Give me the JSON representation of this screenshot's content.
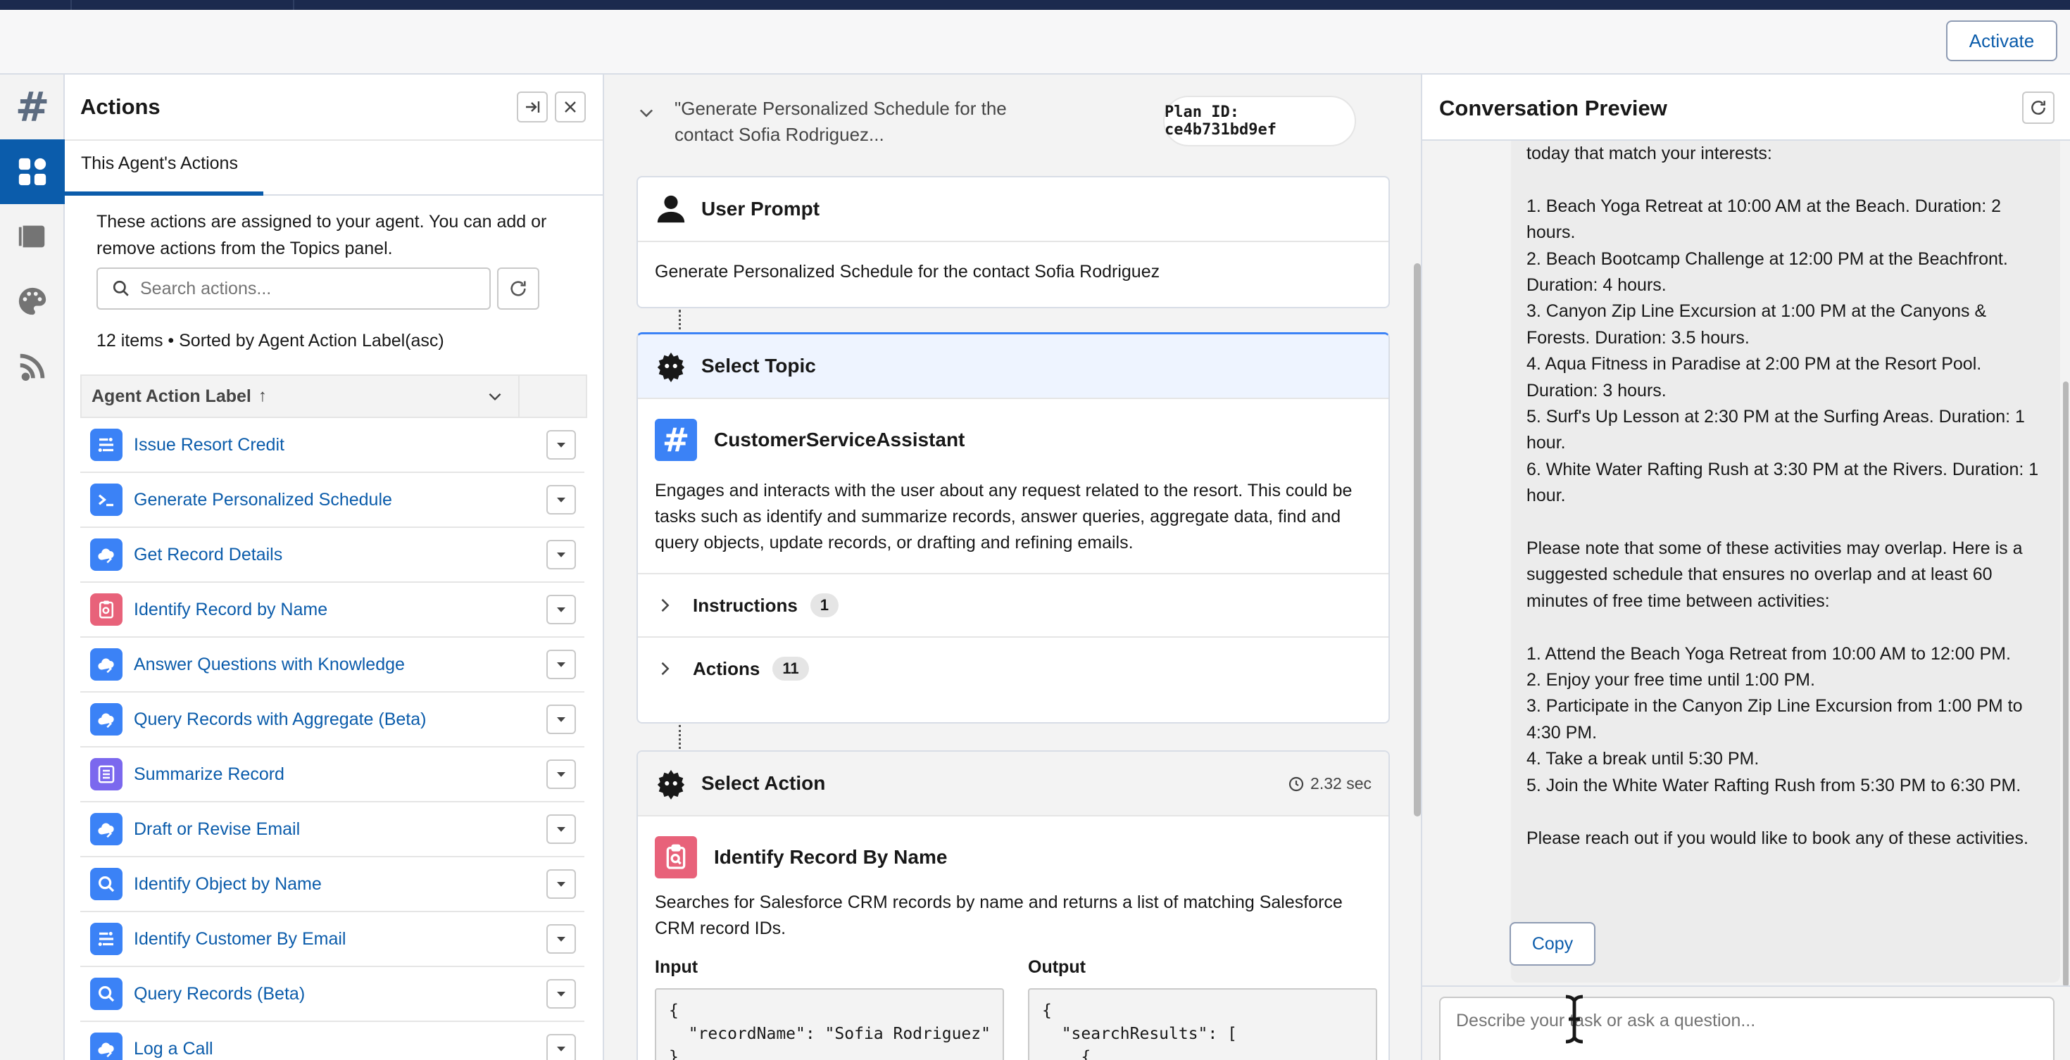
{
  "header": {
    "activate_label": "Activate"
  },
  "rail": {
    "items": [
      {
        "icon": "hash-icon"
      },
      {
        "icon": "apps-icon",
        "active": true
      },
      {
        "icon": "book-icon"
      },
      {
        "icon": "palette-icon"
      },
      {
        "icon": "signal-icon"
      }
    ]
  },
  "actions_panel": {
    "title": "Actions",
    "tab_label": "This Agent's Actions",
    "description": "These actions are assigned to your agent. You can add or remove actions from the Topics panel.",
    "search_placeholder": "Search actions...",
    "count_text": "12 items • Sorted by Agent Action Label(asc)",
    "column_header": "Agent Action Label",
    "sort_arrow": "↑",
    "rows": [
      {
        "label": "Issue Resort Credit",
        "icon": "flow-icon",
        "color": "#3b82f6"
      },
      {
        "label": "Generate Personalized Schedule",
        "icon": "prompt-icon",
        "color": "#3b82f6"
      },
      {
        "label": "Get Record Details",
        "icon": "cloud-icon",
        "color": "#3b82f6"
      },
      {
        "label": "Identify Record by Name",
        "icon": "clipboard-icon",
        "color": "#e8627a"
      },
      {
        "label": "Answer Questions with Knowledge",
        "icon": "cloud-icon",
        "color": "#3b82f6"
      },
      {
        "label": "Query Records with Aggregate (Beta)",
        "icon": "cloud-icon",
        "color": "#3b82f6"
      },
      {
        "label": "Summarize Record",
        "icon": "list-icon",
        "color": "#7b68ee"
      },
      {
        "label": "Draft or Revise Email",
        "icon": "cloud-icon",
        "color": "#3b82f6"
      },
      {
        "label": "Identify Object by Name",
        "icon": "search-icon",
        "color": "#3b82f6"
      },
      {
        "label": "Identify Customer By Email",
        "icon": "flow-icon",
        "color": "#3b82f6"
      },
      {
        "label": "Query Records (Beta)",
        "icon": "search-icon",
        "color": "#3b82f6"
      },
      {
        "label": "Log a Call",
        "icon": "cloud-icon",
        "color": "#3b82f6"
      }
    ]
  },
  "plan": {
    "title": "\"Generate Personalized Schedule for the contact Sofia Rodriguez...",
    "plan_id": "Plan ID: ce4b731bd9ef",
    "user_prompt": {
      "title": "User Prompt",
      "text": "Generate Personalized Schedule for the contact Sofia Rodriguez"
    },
    "select_topic": {
      "title": "Select Topic",
      "topic_name": "CustomerServiceAssistant",
      "topic_description": "Engages and interacts with the user about any request related to the resort. This could be tasks such as identify and summarize records, answer queries, aggregate data, find and query objects, update records, or drafting and refining emails.",
      "instructions_label": "Instructions",
      "instructions_count": "1",
      "actions_label": "Actions",
      "actions_count": "11"
    },
    "select_action": {
      "title": "Select Action",
      "timing": "2.32 sec",
      "action_name": "Identify Record By Name",
      "action_description": "Searches for Salesforce CRM records by name and returns a list of matching Salesforce CRM record IDs.",
      "input_label": "Input",
      "output_label": "Output",
      "input_code": "{\n  \"recordName\": \"Sofia Rodriguez\"\n}",
      "output_code": "{\n  \"searchResults\": [\n    {"
    }
  },
  "conversation": {
    "title": "Conversation Preview",
    "lines": [
      "today that match your interests:",
      "",
      "1. Beach Yoga Retreat at 10:00 AM at the Beach. Duration: 2 hours.",
      "2. Beach Bootcamp Challenge at 12:00 PM at the Beachfront. Duration: 4 hours.",
      "3. Canyon Zip Line Excursion at 1:00 PM at the Canyons & Forests. Duration: 3.5 hours.",
      "4. Aqua Fitness in Paradise at 2:00 PM at the Resort Pool. Duration: 3 hours.",
      "5. Surf's Up Lesson at 2:30 PM at the Surfing Areas. Duration: 1 hour.",
      "6. White Water Rafting Rush at 3:30 PM at the Rivers. Duration: 1 hour.",
      "",
      "Please note that some of these activities may overlap. Here is a suggested schedule that ensures no overlap and at least 60 minutes of free time between activities:",
      "",
      "1. Attend the Beach Yoga Retreat from 10:00 AM to 12:00 PM.",
      "2. Enjoy your free time until 1:00 PM.",
      "3. Participate in the Canyon Zip Line Excursion from 1:00 PM to 4:30 PM.",
      "4. Take a break until 5:30 PM.",
      "5. Join the White Water Rafting Rush from 5:30 PM to 6:30 PM.",
      "",
      "Please reach out if you would like to book any of these activities."
    ],
    "copy_label": "Copy",
    "input_placeholder": "Describe your task or ask a question..."
  },
  "colors": {
    "brand_blue": "#0b5cab",
    "topbar": "#1b2a4e",
    "topic_badge": "#3b82f6",
    "action_badge": "#e8627a"
  }
}
